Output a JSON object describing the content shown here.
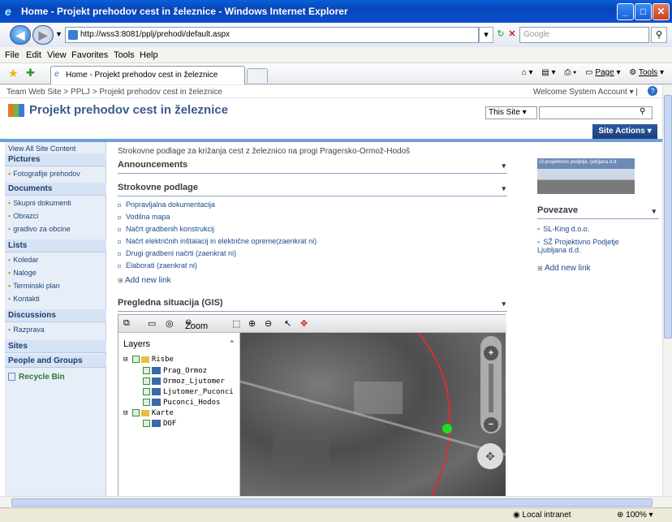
{
  "window": {
    "title": "Home - Projekt prehodov cest in železnice - Windows Internet Explorer",
    "url": "http://wss3:8081/pplj/prehodi/default.aspx",
    "search_placeholder": "Google",
    "tab_title": "Home - Projekt prehodov cest in železnice"
  },
  "menu": [
    "File",
    "Edit",
    "View",
    "Favorites",
    "Tools",
    "Help"
  ],
  "commandbar": {
    "page": "Page",
    "tools": "Tools"
  },
  "site": {
    "breadcrumb": "Team Web Site > PPLJ > Projekt prehodov cest in železnice",
    "welcome": "Welcome System Account",
    "title": "Projekt prehodov cest in železnice",
    "scope": "This Site",
    "site_actions": "Site Actions"
  },
  "quicklaunch": {
    "view_all": "View All Site Content",
    "sections": [
      {
        "title": "Pictures",
        "items": [
          "Fotografije prehodov"
        ]
      },
      {
        "title": "Documents",
        "items": [
          "Skupni dokumenti",
          "Obrazci",
          "gradivo za obcine"
        ]
      },
      {
        "title": "Lists",
        "items": [
          "Koledar",
          "Naloge",
          "Terminski plan",
          "Kontakti"
        ]
      },
      {
        "title": "Discussions",
        "items": [
          "Razprava"
        ]
      },
      {
        "title": "Sites",
        "items": []
      },
      {
        "title": "People and Groups",
        "items": []
      }
    ],
    "recycle": "Recycle Bin"
  },
  "main": {
    "intro": "Strokovne podlage za križanja cest z železnico na progi Pragersko-Ormož-Hodoš",
    "announcements": "Announcements",
    "strokovne": "Strokovne podlage",
    "links": [
      "Pripravljalna dokumentacija",
      "Vodilna mapa",
      "Načrt gradbenih konstrukcij",
      "Načrt električnih inštalacij in električne opreme(zaenkrat ni)",
      "Drugi gradbeni načrti (zaenkrat ni)",
      "Elaborati (zaenkrat ni)"
    ],
    "add_new_link": "Add new link",
    "gis_title": "Pregledna situacija (GIS)"
  },
  "gis": {
    "zoom_label": "Zoom",
    "layers_title": "Layers",
    "groups": [
      {
        "name": "Risbe",
        "layers": [
          "Prag_Ormoz",
          "Ormoz_Ljutomer",
          "Ljutomer_Puconci",
          "Puconci_Hodos"
        ]
      },
      {
        "name": "Karte",
        "layers": [
          "DOF"
        ]
      }
    ]
  },
  "right": {
    "thumb_caption": "sž-projektivno podjetje, ljubljana d.d.",
    "povezave": "Povezave",
    "links": [
      "SL-King d.o.o.",
      "SŽ Projektivno Podjetje Ljubljana d.d."
    ],
    "add_new_link": "Add new link"
  },
  "status": {
    "zone": "Local intranet",
    "zoom": "100%"
  }
}
